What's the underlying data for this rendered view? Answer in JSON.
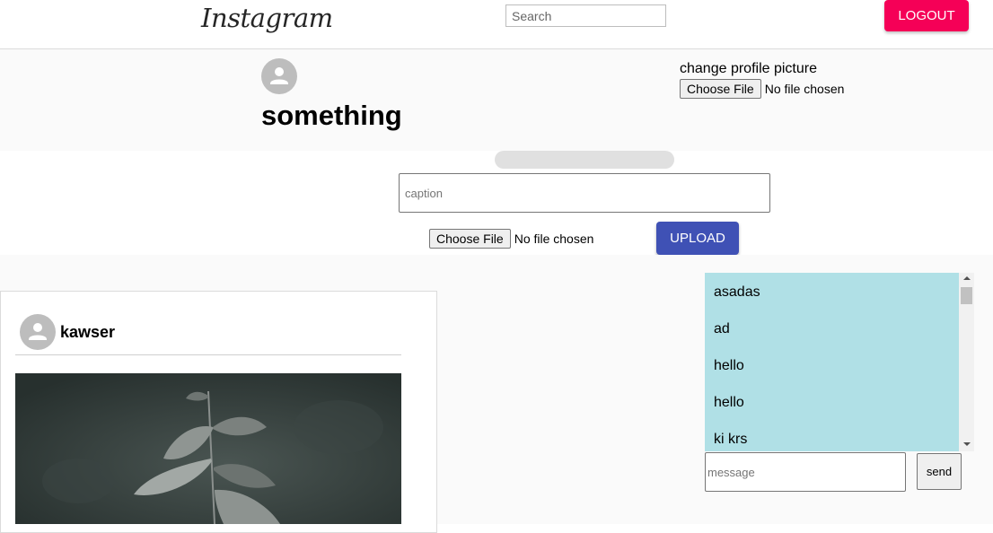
{
  "header": {
    "logo_text": "Instagram",
    "search_placeholder": "Search",
    "logout_label": "LOGOUT"
  },
  "profile": {
    "avatar_icon": "person-icon",
    "name": "something",
    "change_picture_label": "change profile picture",
    "file_button_label": "Choose File",
    "file_status": "No file chosen"
  },
  "upload": {
    "caption_placeholder": "caption",
    "file_button_label": "Choose File",
    "file_status": "No file chosen",
    "upload_label": "UPLOAD",
    "progress": 0
  },
  "post": {
    "avatar_icon": "person-icon",
    "username": "kawser",
    "image_icon": "leaves-photo"
  },
  "chat": {
    "messages": [
      "asadas",
      "ad",
      "hello",
      "hello",
      "ki krs"
    ],
    "message_placeholder": "message",
    "send_label": "send"
  },
  "colors": {
    "logout": "#f50057",
    "upload": "#3f51b5",
    "chat_background": "#b0e0e6",
    "band_background": "#fafafa"
  }
}
